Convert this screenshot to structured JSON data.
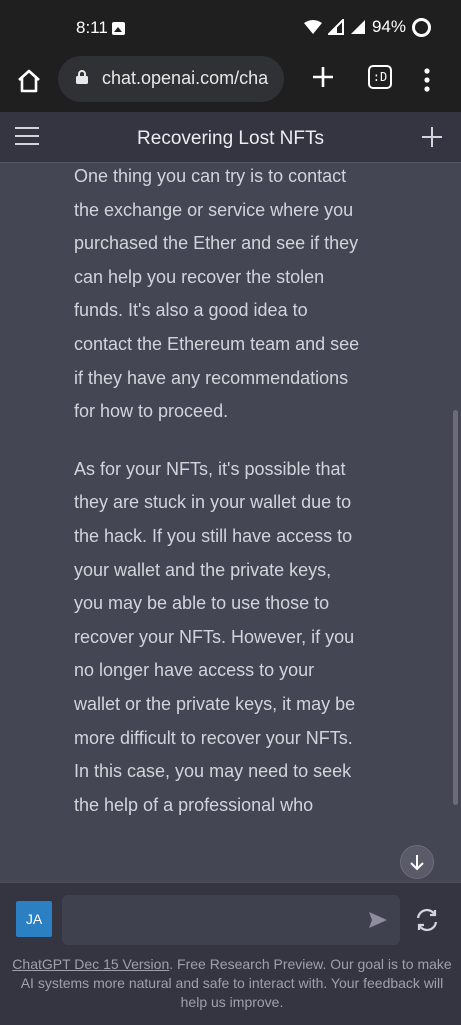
{
  "status_bar": {
    "time": "8:11",
    "battery": "94%"
  },
  "browser": {
    "url": "chat.openai.com/cha",
    "tab_count": ":D"
  },
  "header": {
    "title": "Recovering Lost NFTs"
  },
  "message": {
    "paragraphs": [
      "One thing you can try is to contact the exchange or service where you purchased the Ether and see if they can help you recover the stolen funds. It's also a good idea to contact the Ethereum team and see if they have any recommendations for how to proceed.",
      "As for your NFTs, it's possible that they are stuck in your wallet due to the hack. If you still have access to your wallet and the private keys, you may be able to use those to recover your NFTs. However, if you no longer have access to your wallet or the private keys, it may be more difficult to recover your NFTs. In this case, you may need to seek the help of a professional who"
    ]
  },
  "composer": {
    "avatar_initials": "JA",
    "input_value": "",
    "input_placeholder": ""
  },
  "footer": {
    "link_text": "ChatGPT Dec 15 Version",
    "text": ". Free Research Preview. Our goal is to make AI systems more natural and safe to interact with. Your feedback will help us improve."
  },
  "colors": {
    "accent_avatar": "#2b7fc3",
    "background": "#444654",
    "header": "#343541"
  }
}
